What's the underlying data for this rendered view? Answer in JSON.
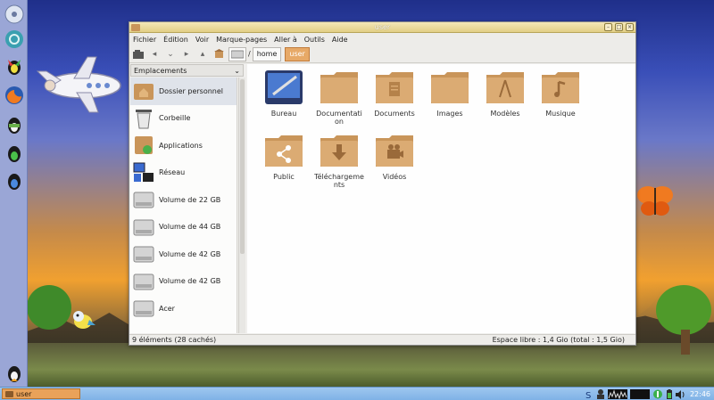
{
  "window": {
    "title": "user",
    "menu": [
      "Fichier",
      "Édition",
      "Voir",
      "Marque-pages",
      "Aller à",
      "Outils",
      "Aide"
    ],
    "path": [
      "home",
      "user"
    ],
    "sidebar_header": "Emplacements",
    "places": [
      {
        "label": "Dossier personnel",
        "icon": "home-folder-icon",
        "selected": true
      },
      {
        "label": "Corbeille",
        "icon": "trash-icon"
      },
      {
        "label": "Applications",
        "icon": "applications-icon"
      },
      {
        "label": "Réseau",
        "icon": "network-icon"
      },
      {
        "label": "Volume de 22 GB",
        "icon": "drive-icon"
      },
      {
        "label": "Volume de 44 GB",
        "icon": "drive-icon"
      },
      {
        "label": "Volume de 42 GB",
        "icon": "drive-icon"
      },
      {
        "label": "Volume de 42 GB",
        "icon": "drive-icon"
      },
      {
        "label": "Acer",
        "icon": "drive-icon"
      }
    ],
    "files": [
      {
        "name": "Bureau",
        "icon": "desktop-folder-icon"
      },
      {
        "name": "Documentation",
        "icon": "folder-icon"
      },
      {
        "name": "Documents",
        "icon": "documents-folder-icon"
      },
      {
        "name": "Images",
        "icon": "folder-icon"
      },
      {
        "name": "Modèles",
        "icon": "templates-folder-icon"
      },
      {
        "name": "Musique",
        "icon": "music-folder-icon"
      },
      {
        "name": "Public",
        "icon": "share-folder-icon"
      },
      {
        "name": "Téléchargements",
        "icon": "download-folder-icon"
      },
      {
        "name": "Vidéos",
        "icon": "video-folder-icon"
      }
    ],
    "status_left": "9 éléments (28 cachés)",
    "status_right": "Espace libre : 1,4 Gio (total : 1,5 Gio)"
  },
  "taskbar": {
    "task_label": "user",
    "clock": "22:46"
  },
  "colors": {
    "folder": "#c9955a",
    "folder_light": "#e2b57c",
    "accent": "#e7a967",
    "taskbar": "#8bbbe9",
    "dock": "#9aa6d6"
  }
}
